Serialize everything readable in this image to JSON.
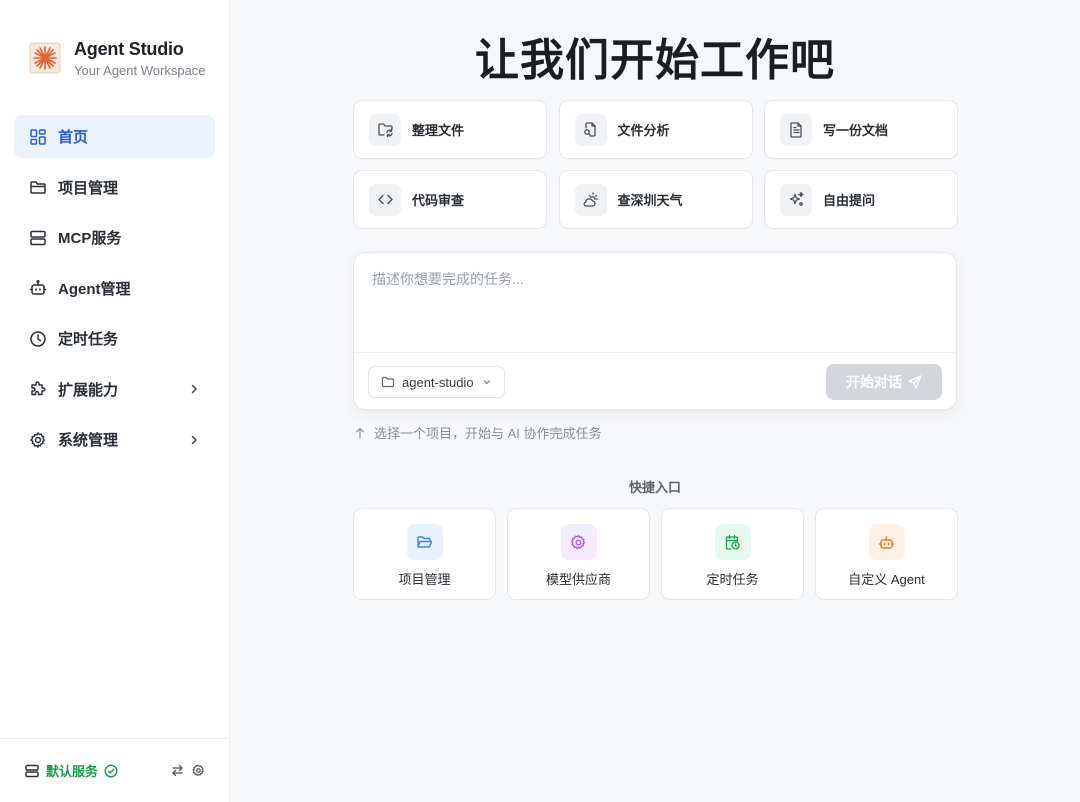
{
  "brand": {
    "title": "Agent Studio",
    "subtitle": "Your Agent Workspace",
    "logo_icon": "asterisk-logo-icon",
    "accent": "#e0622f"
  },
  "sidebar": {
    "items": [
      {
        "label": "首页",
        "icon": "dashboard-grid-icon",
        "active": true,
        "expandable": false
      },
      {
        "label": "项目管理",
        "icon": "folder-icon",
        "active": false,
        "expandable": false
      },
      {
        "label": "MCP服务",
        "icon": "server-icon",
        "active": false,
        "expandable": false
      },
      {
        "label": "Agent管理",
        "icon": "bot-icon",
        "active": false,
        "expandable": false
      },
      {
        "label": "定时任务",
        "icon": "clock-icon",
        "active": false,
        "expandable": false
      },
      {
        "label": "扩展能力",
        "icon": "puzzle-icon",
        "active": false,
        "expandable": true
      },
      {
        "label": "系统管理",
        "icon": "gear-icon",
        "active": false,
        "expandable": true
      }
    ],
    "footer": {
      "service_label": "默认服务",
      "status": "connected",
      "status_color": "#1a9b4b"
    }
  },
  "main": {
    "headline": "让我们开始工作吧",
    "quick_actions": [
      {
        "label": "整理文件",
        "icon": "folder-sync-icon"
      },
      {
        "label": "文件分析",
        "icon": "file-search-icon"
      },
      {
        "label": "写一份文档",
        "icon": "file-text-icon"
      },
      {
        "label": "代码审查",
        "icon": "code-icon"
      },
      {
        "label": "查深圳天气",
        "icon": "weather-icon"
      },
      {
        "label": "自由提问",
        "icon": "sparkles-icon"
      }
    ],
    "composer": {
      "placeholder": "描述你想要完成的任务...",
      "project": "agent-studio",
      "send_label": "开始对话"
    },
    "hint": "选择一个项目，开始与 AI 协作完成任务",
    "shortcuts_title": "快捷入口",
    "shortcuts": [
      {
        "label": "项目管理",
        "icon": "folder-open-icon",
        "color": "#3b82f6",
        "bg": "#e8f1fe"
      },
      {
        "label": "模型供应商",
        "icon": "gear-icon",
        "color": "#a855f7",
        "bg": "#f5ebfe"
      },
      {
        "label": "定时任务",
        "icon": "calendar-clock-icon",
        "color": "#16a34a",
        "bg": "#e7f8ec"
      },
      {
        "label": "自定义 Agent",
        "icon": "bot-icon",
        "color": "#f97316",
        "bg": "#fff1e6"
      }
    ]
  }
}
